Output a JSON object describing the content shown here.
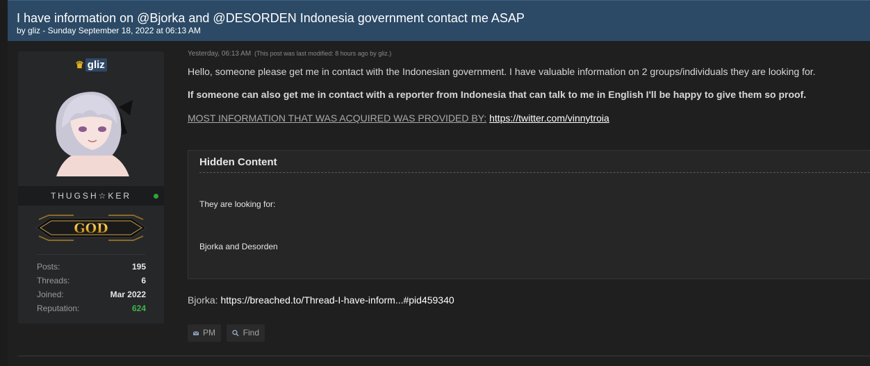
{
  "thread": {
    "title": "I have information on @Bjorka and @DESORDEN Indonesia government contact me ASAP",
    "meta": "by gliz - Sunday September 18, 2022 at 06:13 AM"
  },
  "user": {
    "name": "gliz",
    "usertitle": "THUGSH☆KER",
    "rank": "GOD",
    "stats": [
      {
        "label": "Posts:",
        "value": "195"
      },
      {
        "label": "Threads:",
        "value": "6"
      },
      {
        "label": "Joined:",
        "value": "Mar 2022"
      },
      {
        "label": "Reputation:",
        "value": "624"
      }
    ],
    "online": true
  },
  "post": {
    "date": "Yesterday, 06:13 AM",
    "edited": "(This post was last modified: 8 hours ago by gliz.)",
    "p1": "Hello, someone please get me in contact with the Indonesian government. I have valuable information on 2 groups/individuals they are looking for.",
    "p2": "If someone can also get me in contact with a reporter from Indonesia that can talk to me in English I'll be happy to give them so proof.",
    "p3_text": "MOST INFORMATION THAT WAS ACQUIRED WAS PROVIDED BY:",
    "p3_link": "https://twitter.com/vinnytroia",
    "hidden": {
      "title": "Hidden Content",
      "line1": "They are looking for:",
      "line2": "Bjorka and Desorden"
    },
    "bjorka_label": "Bjorka:",
    "bjorka_link": "https://breached.to/Thread-I-have-inform...#pid459340"
  },
  "buttons": {
    "pm": "PM",
    "find": "Find"
  },
  "colors": {
    "header_bg": "#2c4a66",
    "reputation": "#3fb54a",
    "online": "#2ea43a",
    "crown": "#e2b51f"
  },
  "icons": [
    "crown-icon",
    "envelope-icon",
    "search-icon"
  ]
}
